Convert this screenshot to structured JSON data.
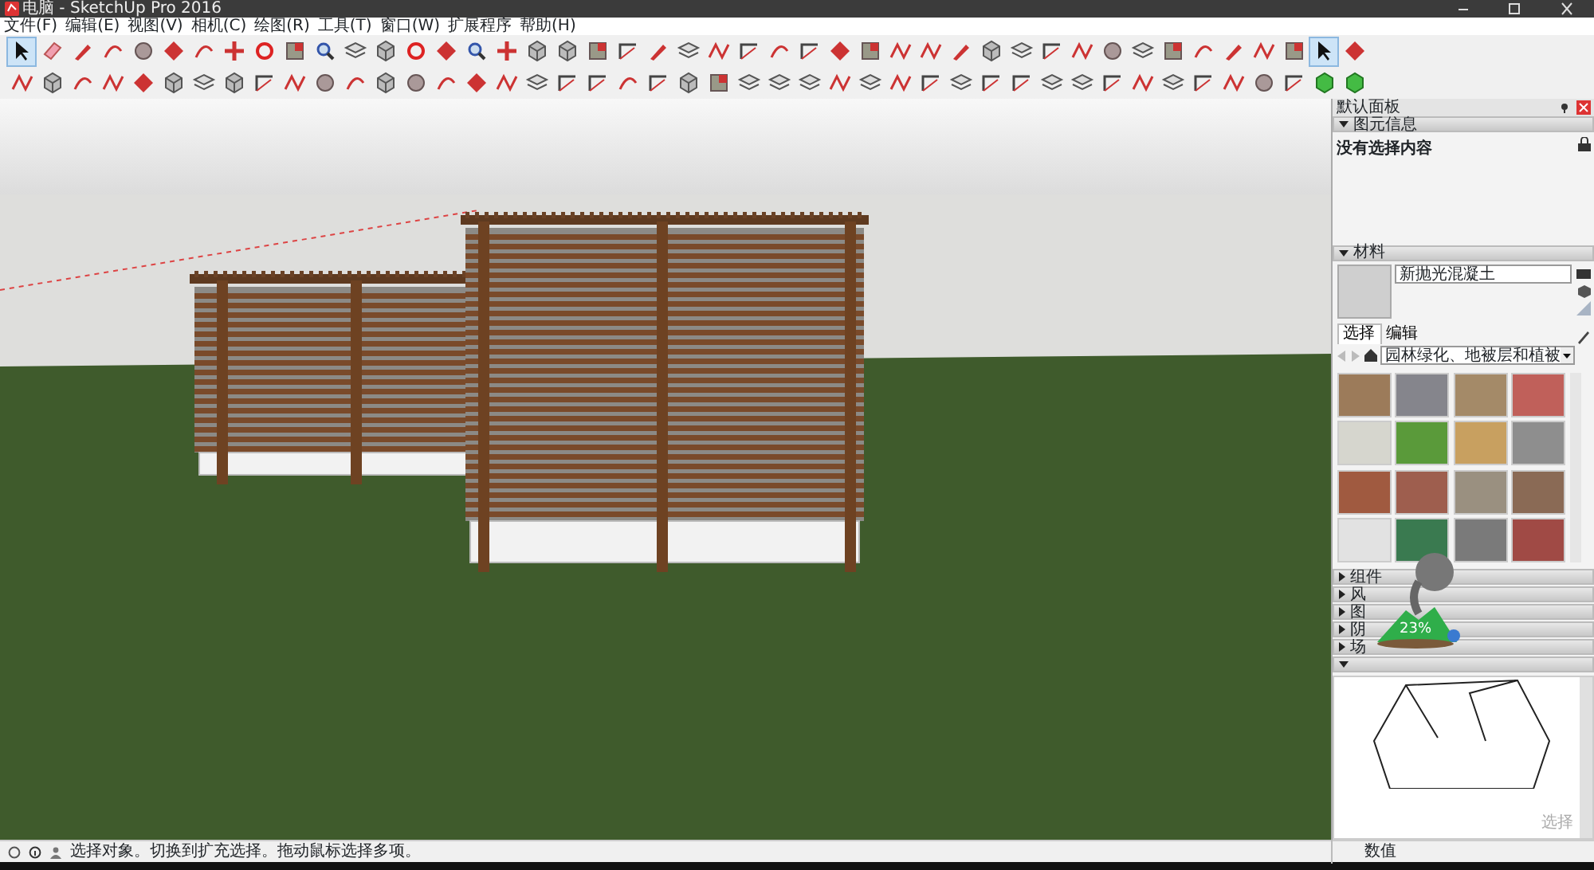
{
  "window": {
    "title": "电脑 - SketchUp Pro 2016"
  },
  "menu": [
    "文件(F)",
    "编辑(E)",
    "视图(V)",
    "相机(C)",
    "绘图(R)",
    "工具(T)",
    "窗口(W)",
    "扩展程序",
    "帮助(H)"
  ],
  "toolbars": [
    {
      "tools": [
        {
          "selected": true
        },
        {
          "selected": false
        },
        {
          "selected": false
        },
        {
          "selected": false
        },
        {
          "selected": false
        },
        {
          "selected": false
        },
        {
          "selected": false
        },
        {
          "selected": false
        },
        {
          "selected": false
        },
        {
          "selected": false
        },
        {
          "selected": false
        },
        {
          "selected": false
        },
        {
          "selected": false
        },
        {
          "selected": false
        },
        {
          "selected": false
        },
        {
          "selected": false
        },
        {
          "selected": false
        },
        {
          "selected": false
        },
        {
          "selected": false
        },
        {
          "selected": false
        },
        {
          "selected": false
        },
        {
          "selected": false
        },
        {
          "selected": false
        },
        {
          "selected": false
        },
        {
          "selected": false
        },
        {
          "selected": false
        },
        {
          "selected": false
        },
        {
          "selected": false
        },
        {
          "selected": false
        },
        {
          "selected": false
        },
        {
          "selected": false
        },
        {
          "selected": false
        },
        {
          "selected": false
        },
        {
          "selected": false
        },
        {
          "selected": false
        },
        {
          "selected": false
        },
        {
          "selected": false
        },
        {
          "selected": false
        },
        {
          "selected": false
        },
        {
          "selected": false
        },
        {
          "selected": false
        },
        {
          "selected": false
        },
        {
          "selected": false
        },
        {
          "selected": true
        },
        {
          "selected": false
        }
      ]
    },
    {
      "tools": [
        {
          "selected": false
        },
        {
          "selected": false
        },
        {
          "selected": false
        },
        {
          "selected": false
        },
        {
          "selected": false
        },
        {
          "selected": false
        },
        {
          "selected": false
        },
        {
          "selected": false
        },
        {
          "selected": false
        },
        {
          "selected": false
        },
        {
          "selected": false
        },
        {
          "selected": false
        },
        {
          "selected": false
        },
        {
          "selected": false
        },
        {
          "selected": false
        },
        {
          "selected": false
        },
        {
          "selected": false
        },
        {
          "selected": false
        },
        {
          "selected": false
        },
        {
          "selected": false
        },
        {
          "selected": false
        },
        {
          "selected": false
        },
        {
          "selected": false
        },
        {
          "selected": false
        },
        {
          "selected": false
        },
        {
          "selected": false
        },
        {
          "selected": false
        },
        {
          "selected": false
        },
        {
          "selected": false
        },
        {
          "selected": false
        },
        {
          "selected": false
        },
        {
          "selected": false
        },
        {
          "selected": false
        },
        {
          "selected": false
        },
        {
          "selected": false
        },
        {
          "selected": false
        },
        {
          "selected": false
        },
        {
          "selected": false
        },
        {
          "selected": false
        },
        {
          "selected": false
        },
        {
          "selected": false
        },
        {
          "selected": false
        },
        {
          "selected": false
        },
        {
          "selected": false
        },
        {
          "selected": false
        }
      ]
    }
  ],
  "tray": {
    "title": "默认面板"
  },
  "entity_info": {
    "title": "图元信息",
    "expanded": true,
    "text": "没有选择内容"
  },
  "materials": {
    "title": "材料",
    "expanded": true,
    "name": "新抛光混凝土",
    "tabs": [
      {
        "label": "选择",
        "selected": true
      },
      {
        "label": "编辑",
        "selected": false
      }
    ],
    "library": "园林绿化、地被层和植被",
    "swatches": [
      {
        "color": "#9c7b5a"
      },
      {
        "color": "#85858c"
      },
      {
        "color": "#a48a68"
      },
      {
        "color": "#c0605a"
      },
      {
        "color": "#d6d6ce"
      },
      {
        "color": "#5a9a3a"
      },
      {
        "color": "#c8a060"
      },
      {
        "color": "#8e8e8e"
      },
      {
        "color": "#a05a40"
      },
      {
        "color": "#9e5e4e"
      },
      {
        "color": "#9a9080"
      },
      {
        "color": "#8a6a55"
      },
      {
        "color": "#e2e2e2"
      },
      {
        "color": "#3a7a50"
      },
      {
        "color": "#7a7a7a"
      },
      {
        "color": "#a04a45"
      }
    ]
  },
  "collapsed_panels": [
    {
      "title": "组件",
      "expanded": false
    },
    {
      "title": "风",
      "expanded": false
    },
    {
      "title": "图",
      "expanded": false
    },
    {
      "title": "阴",
      "expanded": false
    },
    {
      "title": "场",
      "expanded": false
    },
    {
      "expanded": true
    }
  ],
  "preview": {
    "label": "选择"
  },
  "overlay": {
    "percent": "23%"
  },
  "status_bar": {
    "text": "选择对象。切换到扩充选择。拖动鼠标选择多项。",
    "measurements_label": "数值"
  }
}
